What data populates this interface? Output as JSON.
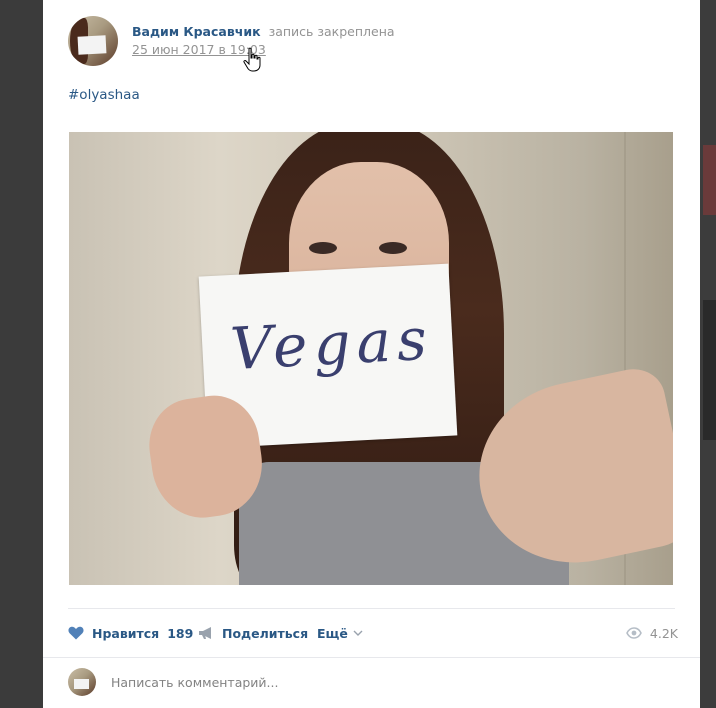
{
  "post": {
    "author_name": "Вадим Красавчик",
    "pinned_label": "запись закреплена",
    "date": "25 июн 2017 в 19:03",
    "hashtag": "#olyashaa",
    "photo_text": "Vegas"
  },
  "actions": {
    "like_label": "Нравится",
    "like_count": "189",
    "share_label": "Поделиться",
    "more_label": "Ещё",
    "views_count": "4.2K"
  },
  "comment": {
    "placeholder": "Написать комментарий..."
  },
  "colors": {
    "link": "#2a5885",
    "muted": "#939393",
    "like_heart": "#5181b8"
  },
  "icons": [
    "heart-icon",
    "megaphone-icon",
    "chevron-down-icon",
    "eye-icon",
    "hand-cursor-icon"
  ]
}
